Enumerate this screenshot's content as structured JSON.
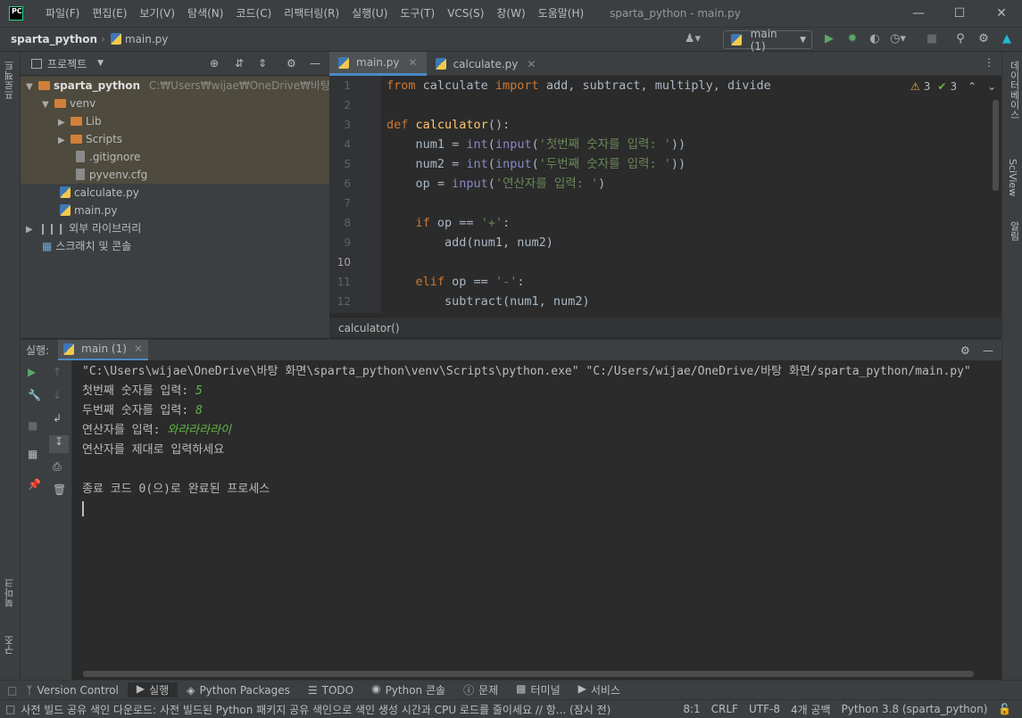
{
  "window": {
    "app_logo": "PC",
    "title": "sparta_python - main.py"
  },
  "menu": [
    "파일(F)",
    "편집(E)",
    "보기(V)",
    "탐색(N)",
    "코드(C)",
    "리팩터링(R)",
    "실행(U)",
    "도구(T)",
    "VCS(S)",
    "창(W)",
    "도움말(H)"
  ],
  "nav": {
    "project": "sparta_python",
    "file": "main.py",
    "run_config": "main (1)"
  },
  "left_stripe": {
    "project": "프로젝트",
    "bookmarks": "북마크",
    "structure": "구조"
  },
  "right_stripe": {
    "database": "데이터베이스",
    "sciview": "SciView",
    "notifications": "알림"
  },
  "project_panel": {
    "title": "프로젝트",
    "root": "sparta_python",
    "root_path": "C:₩Users₩wijae₩OneDrive₩바탕 화면₩spa",
    "items": {
      "venv": "venv",
      "lib": "Lib",
      "scripts": "Scripts",
      "gitignore": ".gitignore",
      "pyvenv": "pyvenv.cfg",
      "calculate": "calculate.py",
      "main": "main.py",
      "ext_libs": "외부 라이브러리",
      "scratches": "스크래치 및 콘솔"
    }
  },
  "editor": {
    "tabs": [
      "main.py",
      "calculate.py"
    ],
    "inspections": {
      "warnings": "3",
      "ok": "3"
    },
    "breadcrumb": "calculator()",
    "line_numbers": [
      "1",
      "2",
      "3",
      "4",
      "5",
      "6",
      "7",
      "8",
      "9",
      "10",
      "11",
      "12"
    ]
  },
  "run": {
    "label": "실행:",
    "tab": "main (1)",
    "lines": {
      "cmd": "\"C:\\Users\\wijae\\OneDrive\\바탕 화면\\sparta_python\\venv\\Scripts\\python.exe\" \"C:/Users/wijae/OneDrive/바탕 화면/sparta_python/main.py\"",
      "p1": "첫번째 숫자를 입력: ",
      "v1": "5",
      "p2": "두번째 숫자를 입력: ",
      "v2": "8",
      "p3": "연산자를 입력: ",
      "v3": "와라라라라이",
      "msg": "연산자를 제대로 입력하세요",
      "exit": "종료 코드 0(으)로 완료된 프로세스"
    }
  },
  "bottom_tabs": [
    "Version Control",
    "실행",
    "Python Packages",
    "TODO",
    "Python 콘솔",
    "문제",
    "터미널",
    "서비스"
  ],
  "status": {
    "message": "사전 빌드 공유 색인 다운로드: 사전 빌드된 Python 패키지 공유 색인으로 색인 생성 시간과 CPU 로드를 줄이세요 // 항... (잠시 전)",
    "position": "8:1",
    "line_sep": "CRLF",
    "encoding": "UTF-8",
    "indent": "4개 공백",
    "interpreter": "Python 3.8 (sparta_python)"
  }
}
